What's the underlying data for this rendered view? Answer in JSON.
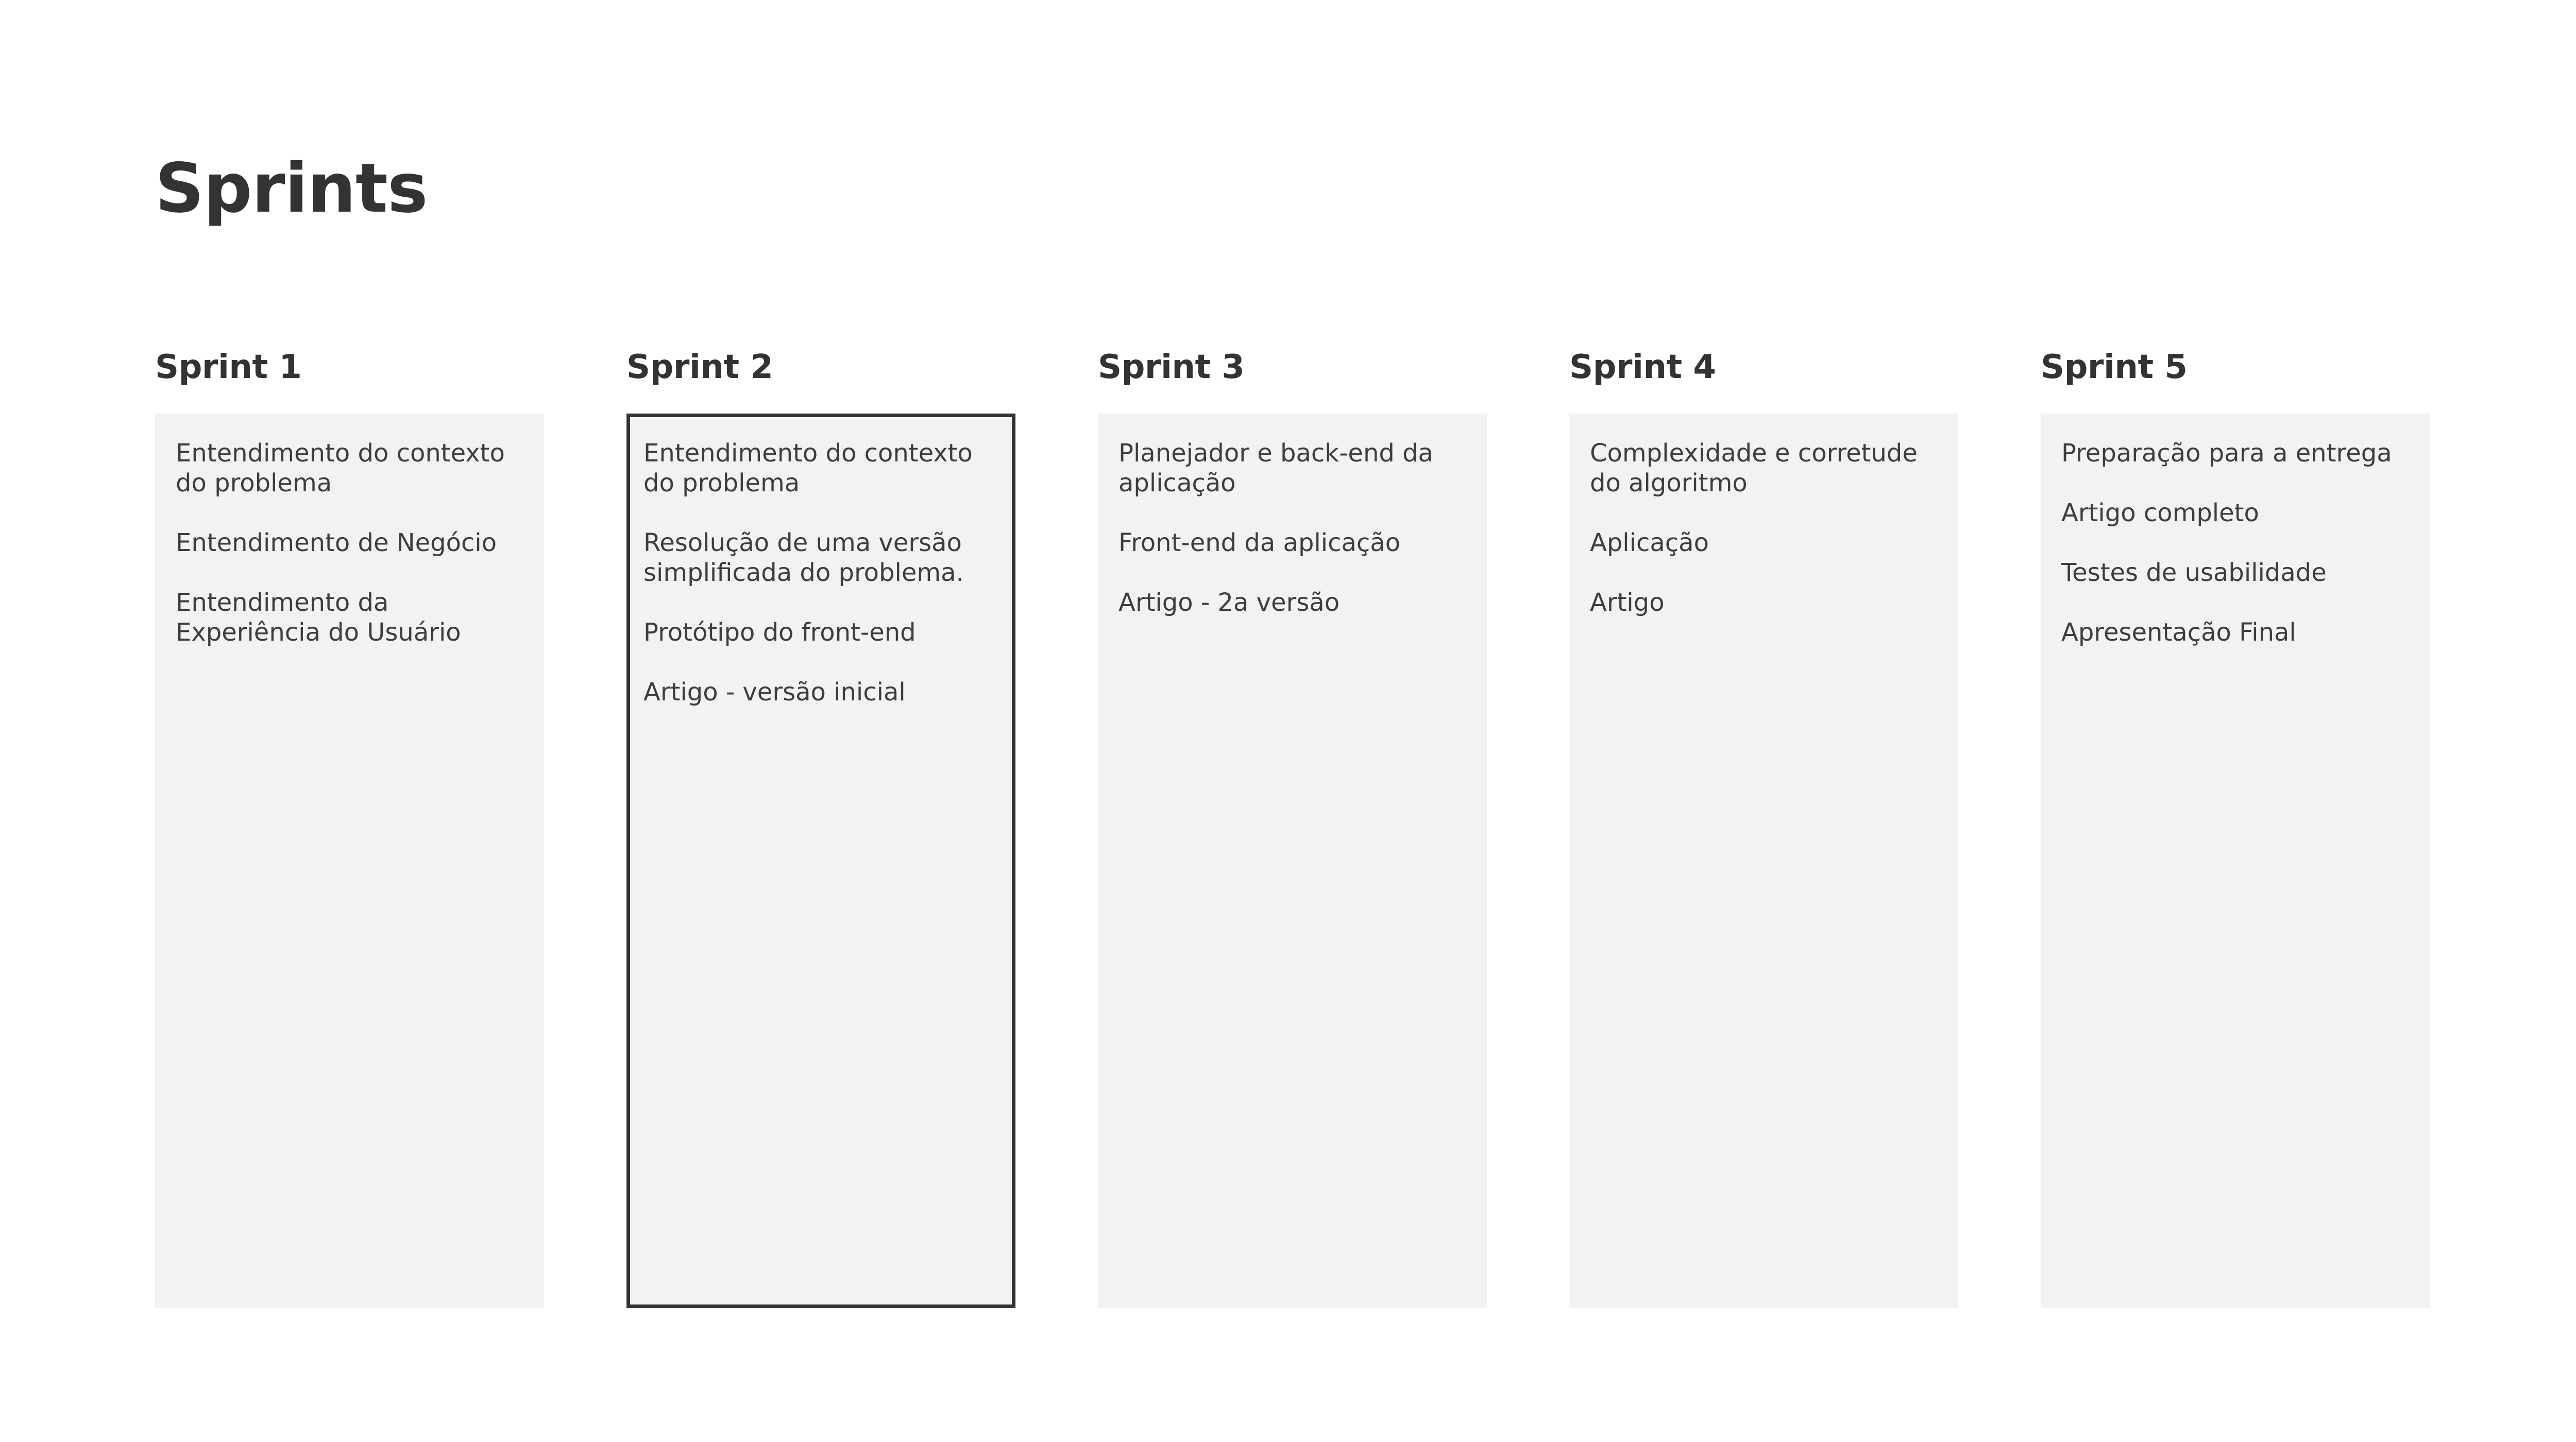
{
  "title": "Sprints",
  "sprints": [
    {
      "name": "Sprint 1",
      "items": [
        "Entendimento do contexto do problema",
        "Entendimento de Negócio",
        "Entendimento da Experiência do Usuário"
      ]
    },
    {
      "name": "Sprint 2",
      "selected": true,
      "items": [
        "Entendimento do contexto do problema",
        "Resolução de uma versão simplificada do problema.",
        "Protótipo do front-end",
        "Artigo - versão inicial"
      ]
    },
    {
      "name": "Sprint 3",
      "items": [
        "Planejador e back-end da aplicação",
        "Front-end da aplicação",
        "Artigo - 2a versão"
      ]
    },
    {
      "name": "Sprint 4",
      "items": [
        "Complexidade e corretude do algoritmo",
        "Aplicação",
        "Artigo"
      ]
    },
    {
      "name": "Sprint 5",
      "items": [
        "Preparação para a entrega",
        "Artigo completo",
        "Testes de usabilidade",
        "Apresentação Final"
      ]
    }
  ],
  "colors": {
    "text": "#333333",
    "card_background": "#f2f2f2",
    "selected_border": "#333333",
    "page_background": "#ffffff"
  }
}
